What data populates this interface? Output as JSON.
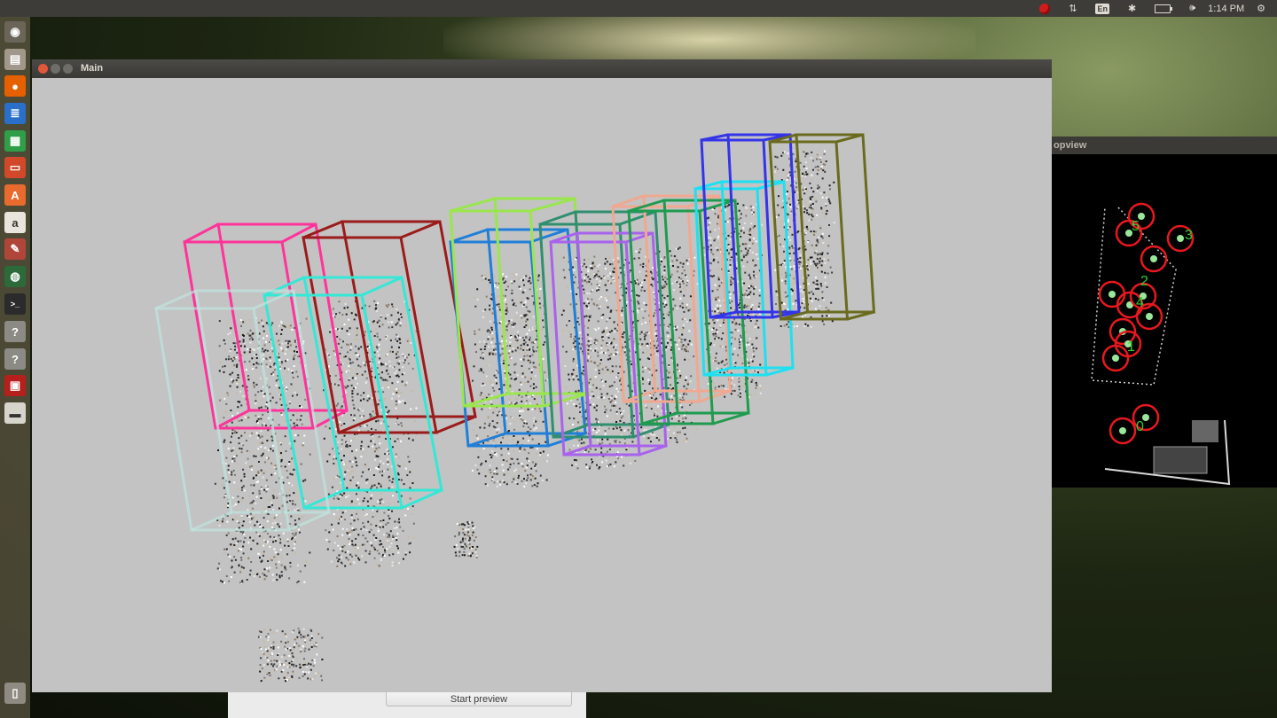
{
  "top_panel": {
    "language": "En",
    "clock": "1:14 PM"
  },
  "launcher": {
    "items": [
      {
        "icon": "dash-home-icon",
        "color": "#6b6459"
      },
      {
        "icon": "files-icon",
        "color": "#a1978a"
      },
      {
        "icon": "firefox-icon",
        "color": "#e66000"
      },
      {
        "icon": "writer-icon",
        "color": "#2a6fc9"
      },
      {
        "icon": "calc-icon",
        "color": "#2e9e48"
      },
      {
        "icon": "impress-icon",
        "color": "#d1482b"
      },
      {
        "icon": "software-center-icon",
        "color": "#e86a2c"
      },
      {
        "icon": "amazon-icon",
        "color": "#e9e5dc"
      },
      {
        "icon": "system-settings-icon",
        "color": "#b0463a"
      },
      {
        "icon": "globe-icon",
        "color": "#2c6a3a"
      },
      {
        "icon": "terminal-icon",
        "color": "#2b2b2b"
      },
      {
        "icon": "unknown-app-icon",
        "color": "#8c8a85"
      },
      {
        "icon": "unknown-app-icon",
        "color": "#8c8a85"
      },
      {
        "icon": "media-app-icon",
        "color": "#b5201c"
      },
      {
        "icon": "drive-icon",
        "color": "#d7d4cc"
      },
      {
        "icon": "trash-icon",
        "color": "#8f8b82"
      }
    ]
  },
  "main_window": {
    "title": "Main",
    "bounding_boxes": [
      {
        "color": "#ff3399",
        "label": "pink"
      },
      {
        "color": "#9b1b1b",
        "label": "dark-red"
      },
      {
        "color": "#33e8d6",
        "label": "turquoise"
      },
      {
        "color": "#bfe6df",
        "label": "pale-cyan"
      },
      {
        "color": "#1f7fd8",
        "label": "blue"
      },
      {
        "color": "#9ae64d",
        "label": "light-green"
      },
      {
        "color": "#2f8f6f",
        "label": "teal-green"
      },
      {
        "color": "#a862ec",
        "label": "violet"
      },
      {
        "color": "#f0a890",
        "label": "salmon"
      },
      {
        "color": "#1f9b4f",
        "label": "green"
      },
      {
        "color": "#1fe0f0",
        "label": "cyan"
      },
      {
        "color": "#3434e8",
        "label": "indigo"
      },
      {
        "color": "#6b6b1f",
        "label": "olive"
      }
    ]
  },
  "topview_window": {
    "title": "opview",
    "tracks": [
      {
        "id": "5"
      },
      {
        "id": "3"
      },
      {
        "id": "2"
      },
      {
        "id": "4"
      },
      {
        "id": "1"
      },
      {
        "id": "0"
      }
    ],
    "marker_color": "#e8181e",
    "label_color": "#33cc33"
  },
  "preview_dialog": {
    "start_button_label": "Start preview"
  }
}
